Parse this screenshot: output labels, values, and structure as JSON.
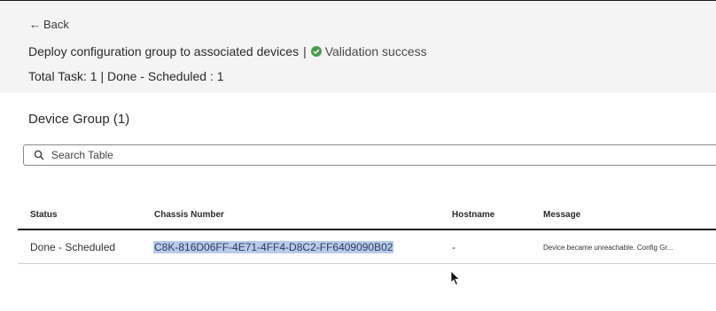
{
  "header": {
    "back_label": "Back",
    "title": "Deploy configuration group to associated devices",
    "separator": "|",
    "validation_status": "Validation success",
    "totals": "Total Task: 1 | Done - Scheduled : 1"
  },
  "section": {
    "title": "Device Group (1)"
  },
  "search": {
    "placeholder": "Search Table"
  },
  "table": {
    "columns": [
      "Status",
      "Chassis Number",
      "Hostname",
      "Message"
    ],
    "rows": [
      {
        "status": "Done - Scheduled",
        "chassis": "C8K-816D06FF-4E71-4FF4-D8C2-FF6409090B02",
        "hostname": "-",
        "message": "Device became unreachable. Config Gr..."
      }
    ]
  },
  "colors": {
    "header_bg": "#f4f4f4",
    "success_green": "#4a9a4f",
    "selection_highlight": "#b9cbe7"
  },
  "icons": [
    "arrow-left-icon",
    "check-circle-icon",
    "search-icon",
    "mouse-pointer-icon"
  ]
}
